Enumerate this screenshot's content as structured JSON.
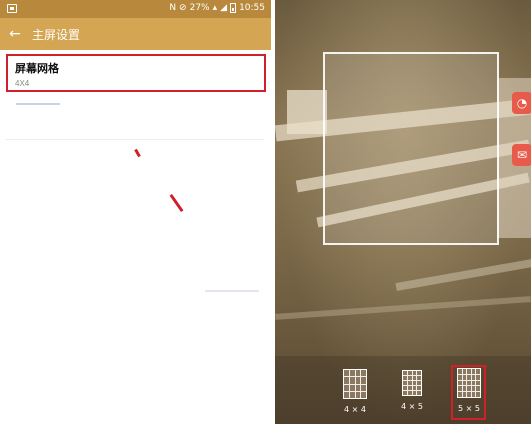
{
  "status_bar": {
    "battery": "27%",
    "time": "10:55",
    "icons": [
      "image-icon",
      "nfc-icon",
      "mute-icon",
      "wifi-icon",
      "signal-icon",
      "battery-icon"
    ]
  },
  "app_bar": {
    "back_icon": "back-arrow-icon",
    "title": "主屏设置"
  },
  "settings_list": {
    "screen_grid": {
      "title": "屏幕网格",
      "value": "4X4"
    }
  },
  "grid_picker": {
    "options": [
      {
        "label": "4 × 4",
        "cols": 4,
        "rows": 4,
        "selected": false
      },
      {
        "label": "4 × 5",
        "cols": 4,
        "rows": 5,
        "selected": false
      },
      {
        "label": "5 × 5",
        "cols": 5,
        "rows": 5,
        "selected": true
      }
    ]
  },
  "colors": {
    "status_bar": "#b8893d",
    "app_bar": "#d4a552",
    "highlight": "#d0202a"
  }
}
